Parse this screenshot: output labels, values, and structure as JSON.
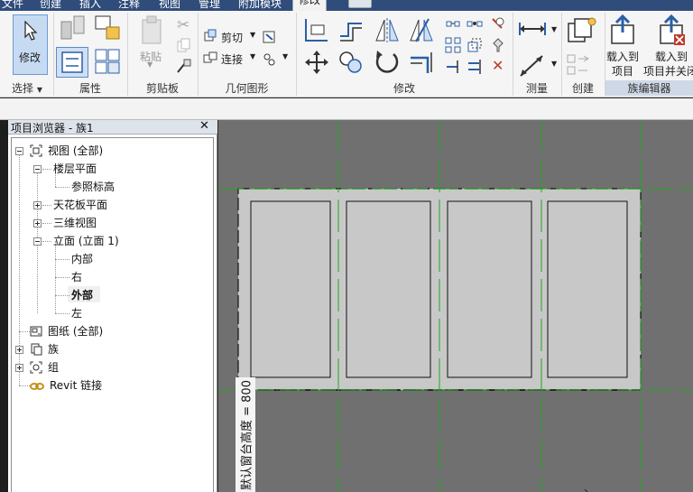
{
  "menu": {
    "tabs": [
      "文件",
      "创建",
      "插入",
      "注释",
      "视图",
      "管理",
      "附加模块",
      "修改"
    ],
    "active_tab": "修改"
  },
  "ribbon": {
    "modify_label": "修改",
    "groups": {
      "select": "选择",
      "properties": "属性",
      "clipboard": "剪贴板",
      "geometry": "几何图形",
      "modify": "修改",
      "measure": "测量",
      "create": "创建",
      "family_editor": "族编辑器"
    },
    "paste_label": "粘贴",
    "cut_label": "剪切",
    "join_label": "连接",
    "load_into_project_label": "载入到\n项目",
    "load_into_project_1": "载入到",
    "load_into_project_2": "项目",
    "load_and_close_1": "载入到",
    "load_and_close_2": "项目并关闭",
    "select_dropdown": "▼"
  },
  "browser": {
    "title": "项目浏览器 - 族1",
    "close": "✕",
    "items": [
      {
        "label": "视图 (全部)"
      },
      {
        "label": "楼层平面"
      },
      {
        "label": "参照标高"
      },
      {
        "label": "天花板平面"
      },
      {
        "label": "三维视图"
      },
      {
        "label": "立面 (立面 1)"
      },
      {
        "label": "内部"
      },
      {
        "label": "右"
      },
      {
        "label": "外部"
      },
      {
        "label": "左"
      },
      {
        "label": "图纸 (全部)"
      },
      {
        "label": "族"
      },
      {
        "label": "组"
      },
      {
        "label": "Revit 链接"
      }
    ]
  },
  "canvas": {
    "dimension_text": "默认窗台高度 = 800",
    "colors": {
      "background": "#707070",
      "panel": "#c8c8c8",
      "reference_line": "#1fa81f"
    }
  }
}
